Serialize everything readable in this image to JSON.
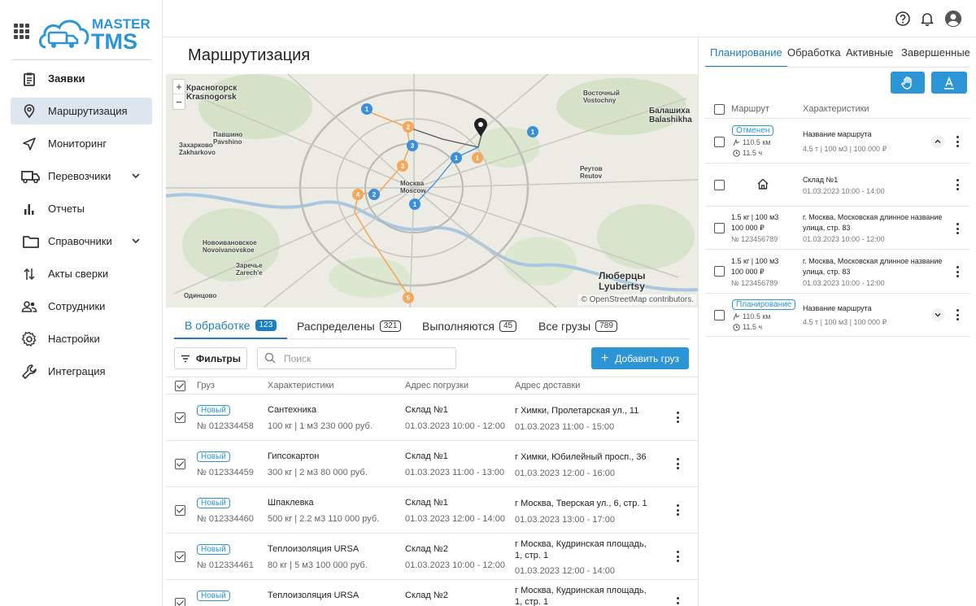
{
  "logo": {
    "line1": "MASTER",
    "line2": "TMS"
  },
  "sidebar": {
    "items": [
      {
        "label": "Заявки",
        "icon": "clipboard-icon"
      },
      {
        "label": "Маршрутизация",
        "icon": "location-pin-icon"
      },
      {
        "label": "Мониторинг",
        "icon": "navigation-arrow-icon"
      },
      {
        "label": "Перевозчики",
        "icon": "truck-icon"
      },
      {
        "label": "Отчеты",
        "icon": "bar-chart-icon"
      },
      {
        "label": "Справочники",
        "icon": "folder-icon"
      },
      {
        "label": "Акты сверки",
        "icon": "swap-vertical-icon"
      },
      {
        "label": "Сотрудники",
        "icon": "people-icon"
      },
      {
        "label": "Настройки",
        "icon": "gear-icon"
      },
      {
        "label": "Интеграция",
        "icon": "wrench-icon"
      }
    ]
  },
  "header": {
    "title": "Маршрутизация"
  },
  "map": {
    "zoom_in": "+",
    "zoom_out": "−",
    "attribution": "© OpenStreetMap contributors.",
    "labels": {
      "krasnogorsk": "Красногорск\nKrasnogorsk",
      "moscow": "Москва\nMoscow",
      "balashikha": "Балашиха\nBalashikha",
      "lyubertsy": "Люберцы\nLyubertsy",
      "vostochny": "Восточный\nVostochny",
      "reutov": "Реутов\nReutov",
      "novoivanovskoe": "Новоивановское\nNovoivanovskoe",
      "zarechye": "Заречье\nZarech'e",
      "pavshino": "Павшино\nPavshino",
      "zakharkovo": "Захарково\nZakharkovo",
      "odintsovo": "Одинцово"
    },
    "markers": [
      "1",
      "2",
      "3",
      "1",
      "1",
      "2",
      "3",
      "4",
      "1",
      "1",
      "5"
    ]
  },
  "tabs": [
    {
      "label": "В обработке",
      "count": "123"
    },
    {
      "label": "Распределены",
      "count": "321"
    },
    {
      "label": "Выполняются",
      "count": "45"
    },
    {
      "label": "Все грузы",
      "count": "789"
    }
  ],
  "toolbar": {
    "filters_label": "Фильтры",
    "search_placeholder": "Поиск",
    "add_label": "Добавить груз"
  },
  "table": {
    "columns": [
      "Груз",
      "Характеристики",
      "Адрес погрузки",
      "Адрес доставки"
    ],
    "rows": [
      {
        "status": "Новый",
        "number": "№ 012334458",
        "name": "Сантехника",
        "specs": "100 кг | 1 м3  230 000 руб.",
        "load_addr": "Склад №1",
        "load_time": "01.03.2023  10:00 - 12:00",
        "deliv_addr": "г Химки, Пролетарская ул., 11",
        "deliv_time": "01.03.2023  11:00 - 15:00"
      },
      {
        "status": "Новый",
        "number": "№ 012334459",
        "name": "Гипсокартон",
        "specs": "300 кг | 2 м3  80 000 руб.",
        "load_addr": "Склад №1",
        "load_time": "01.03.2023  11:00 - 13:00",
        "deliv_addr": "г Химки, Юбилейный просп., 36",
        "deliv_time": "01.03.2023  12:00 - 16:00"
      },
      {
        "status": "Новый",
        "number": "№ 012334460",
        "name": "Шпаклевка",
        "specs": "500 кг | 2.2 м3  110 000 руб.",
        "load_addr": "Склад №1",
        "load_time": "01.03.2023  12:00 - 14:00",
        "deliv_addr": "г Москва, Тверская ул., 6, стр. 1",
        "deliv_time": "01.03.2023  13:00 - 17:00"
      },
      {
        "status": "Новый",
        "number": "№ 012334461",
        "name": "Теплоизоляция URSA",
        "specs": "80 кг | 5 м3  100 000 руб.",
        "load_addr": "Склад №2",
        "load_time": "01.03.2023  10:00 - 12:00",
        "deliv_addr": "г Москва, Кудринская площадь, 1, стр. 1",
        "deliv_time": "01.03.2023  12:00 - 14:00"
      },
      {
        "status": "Новый",
        "number": "",
        "name": "Теплоизоляция URSA",
        "specs": "",
        "load_addr": "Склад №2",
        "load_time": "",
        "deliv_addr": "г Москва, Кудринская площадь, 1, стр. 1",
        "deliv_time": ""
      }
    ]
  },
  "right_panel": {
    "tabs": [
      "Планирование",
      "Обработка",
      "Активные",
      "Завершенные"
    ],
    "columns": [
      "Маршрут",
      "Характеристики"
    ],
    "rows": [
      {
        "status": "Отменен",
        "distance": "110.5 км",
        "duration": "11.5 ч",
        "title": "Название маршрута",
        "sub": "4.5 т | 100 м3 | 100 000 ₽"
      },
      {
        "title": "Склад №1",
        "sub": "01.03.2023  10:00 - 14:00"
      },
      {
        "specs1": "1.5 кг | 100 м3",
        "specs2": "100 000 ₽",
        "number": "№ 123456789",
        "title": "г. Москва, Московская длинное название улица, стр. 83",
        "sub": "01.03.2023  10:00 - 12:00"
      },
      {
        "specs1": "1.5 кг | 100 м3",
        "specs2": "100 000 ₽",
        "number": "№ 123456789",
        "title": "г. Москва, Московская длинное название улица, стр. 83",
        "sub": "01.03.2023  10:00 - 12:00"
      },
      {
        "status": "Планирование",
        "distance": "110.5 км",
        "duration": "11.5 ч",
        "title": "Название маршрута",
        "sub": "4.5 т | 100 м3 | 100 000 ₽"
      }
    ]
  },
  "colors": {
    "accent": "#2b95d6",
    "active_nav_bg": "#dde6ef",
    "marker_blue": "#3b8fd9",
    "marker_orange": "#f5a75b"
  }
}
